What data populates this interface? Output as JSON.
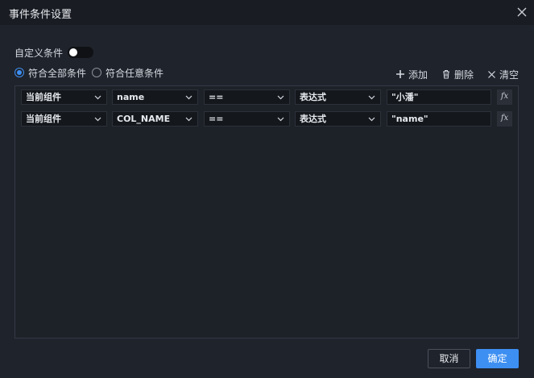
{
  "dialog": {
    "title": "事件条件设置"
  },
  "custom_toggle": {
    "label": "自定义条件",
    "enabled": false
  },
  "match": {
    "options": [
      {
        "label": "符合全部条件",
        "checked": true
      },
      {
        "label": "符合任意条件",
        "checked": false
      }
    ]
  },
  "toolbar": {
    "add_label": "添加",
    "delete_label": "删除",
    "clear_label": "清空"
  },
  "conditions": [
    {
      "component": "当前组件",
      "field": "name",
      "operator": "==",
      "value_type": "表达式",
      "value": "\"小潘\"",
      "fx": "fx"
    },
    {
      "component": "当前组件",
      "field": "COL_NAME",
      "operator": "==",
      "value_type": "表达式",
      "value": "\"name\"",
      "fx": "fx"
    }
  ],
  "footer": {
    "cancel_label": "取消",
    "ok_label": "确定"
  },
  "colors": {
    "accent": "#3d8ff2",
    "background": "#1f232b",
    "titlebar": "#191c22",
    "input": "#14171c"
  }
}
